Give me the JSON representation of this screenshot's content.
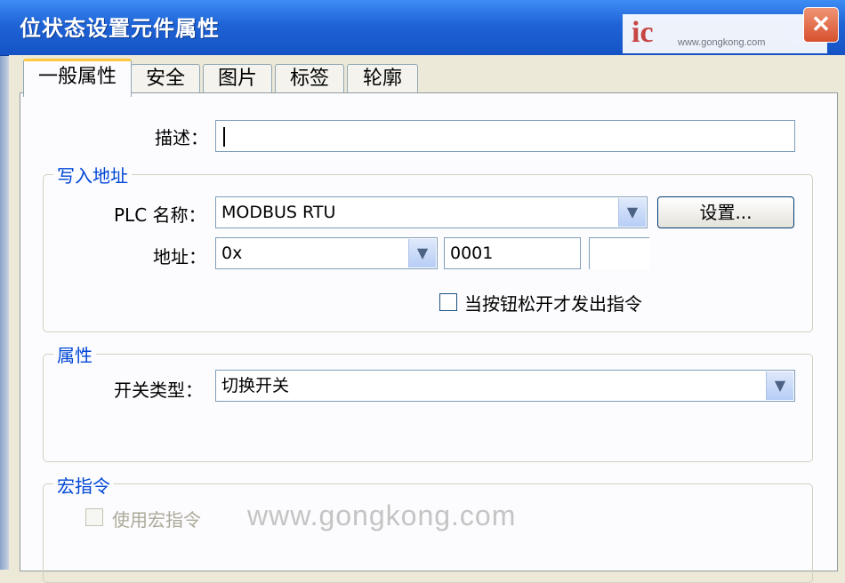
{
  "window": {
    "title": "位状态设置元件属性",
    "close_glyph": "✕"
  },
  "logo": {
    "mark": "ic",
    "url": "www.gongkong.com"
  },
  "tabs": [
    {
      "label": "一般属性",
      "active": true
    },
    {
      "label": "安全",
      "active": false
    },
    {
      "label": "图片",
      "active": false
    },
    {
      "label": "标签",
      "active": false
    },
    {
      "label": "轮廓",
      "active": false
    }
  ],
  "description": {
    "label": "描述：",
    "value": ""
  },
  "write_address": {
    "legend": "写入地址",
    "plc_label": "PLC 名称：",
    "plc_value": "MODBUS RTU",
    "settings_button": "设置...",
    "address_label": "地址：",
    "address_type": "0x",
    "address_value": "0001",
    "address_extra": "",
    "release_checkbox": {
      "label": "当按钮松开才发出指令",
      "checked": false
    }
  },
  "properties": {
    "legend": "属性",
    "switch_type_label": "开关类型：",
    "switch_type_value": "切换开关"
  },
  "macro": {
    "legend": "宏指令",
    "use_macro": {
      "label": "使用宏指令",
      "checked": false,
      "enabled": false
    }
  },
  "watermark": "www.gongkong.com",
  "icons": {
    "dropdown": "chevron-down-icon",
    "close": "close-icon"
  },
  "colors": {
    "title_bar": "#1f63d6",
    "legend": "#0046d5",
    "close": "#d6502e",
    "active_tab": "#ffc83c"
  }
}
